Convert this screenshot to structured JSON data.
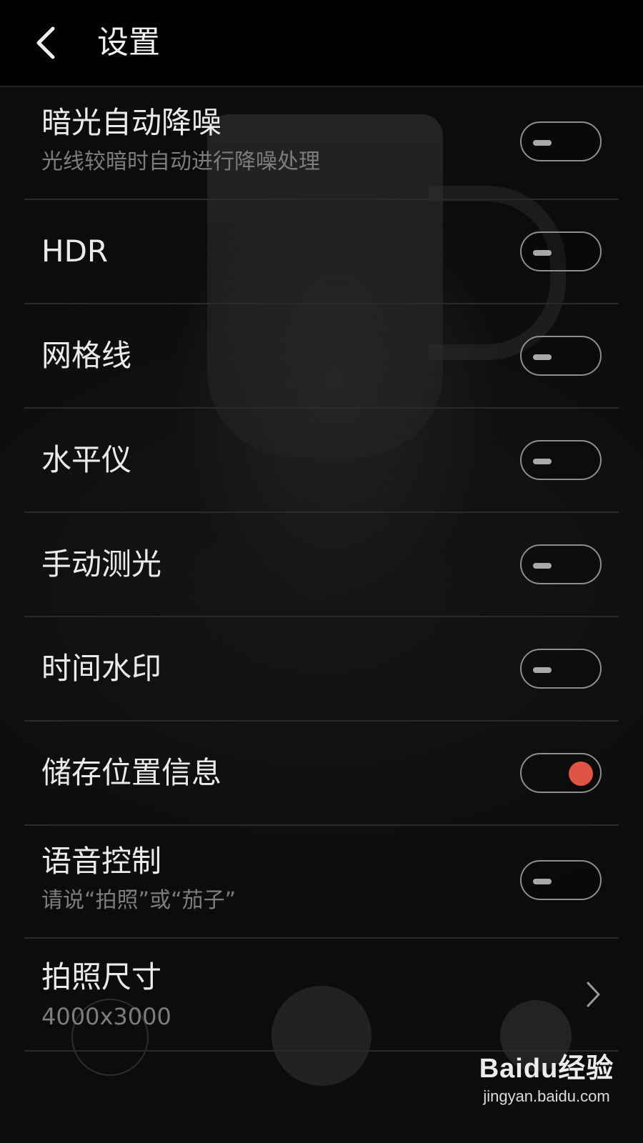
{
  "header": {
    "title": "设置",
    "back_icon": "chevron-left-icon"
  },
  "settings": [
    {
      "label": "暗光自动降噪",
      "sublabel": "光线较暗时自动进行降噪处理",
      "control": "toggle",
      "on": false
    },
    {
      "label": "HDR",
      "control": "toggle",
      "on": false
    },
    {
      "label": "网格线",
      "control": "toggle",
      "on": false
    },
    {
      "label": "水平仪",
      "control": "toggle",
      "on": false
    },
    {
      "label": "手动测光",
      "control": "toggle",
      "on": false
    },
    {
      "label": "时间水印",
      "control": "toggle",
      "on": false
    },
    {
      "label": "储存位置信息",
      "control": "toggle",
      "on": true
    },
    {
      "label": "语音控制",
      "sublabel": "请说“拍照”或“茄子”",
      "control": "toggle",
      "on": false
    },
    {
      "label": "拍照尺寸",
      "sublabel": "4000x3000",
      "control": "chevron",
      "icon": "chevron-right-icon"
    }
  ],
  "watermark": {
    "logo": "Baidu经验",
    "url": "jingyan.baidu.com"
  },
  "colors": {
    "background": "#0c0c0c",
    "header": "#000000",
    "toggle_on_accent": "#e05444",
    "divider": "#2a2a2a"
  }
}
